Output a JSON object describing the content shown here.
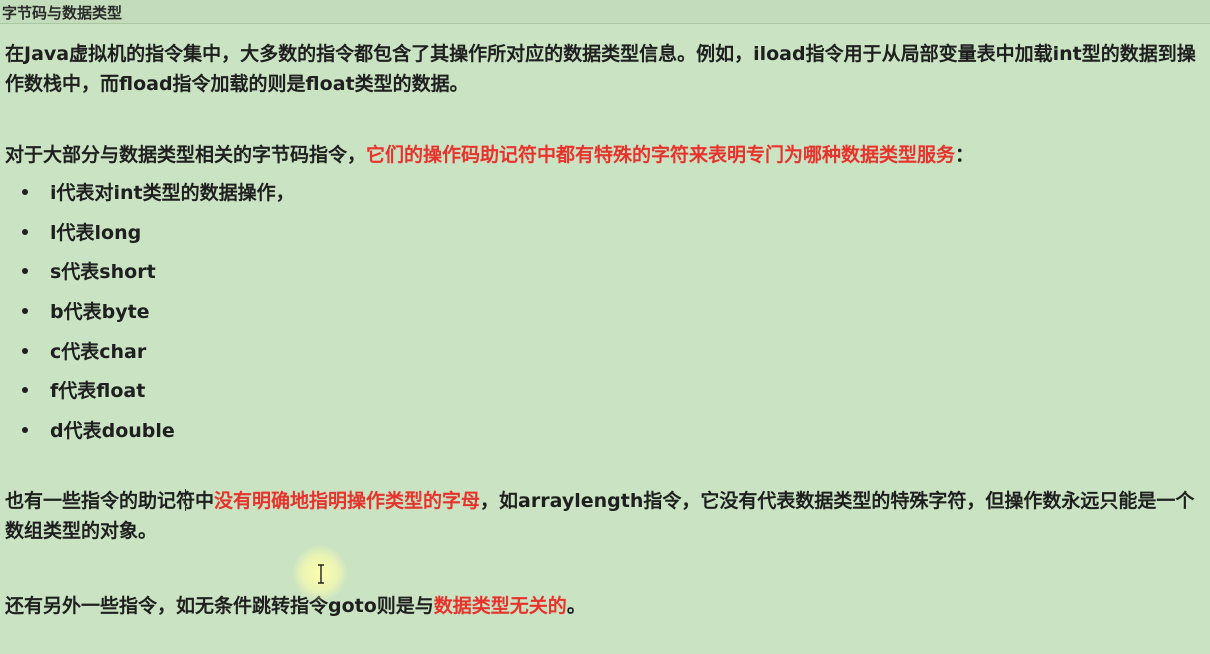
{
  "header": {
    "title": "字节码与数据类型"
  },
  "p1": {
    "text": "在Java虚拟机的指令集中，大多数的指令都包含了其操作所对应的数据类型信息。例如，iload指令用于从局部变量表中加载int型的数据到操作数栈中，而fload指令加载的则是float类型的数据。"
  },
  "p2": {
    "prefix": "对于大部分与数据类型相关的字节码指令，",
    "highlight": "它们的操作码助记符中都有特殊的字符来表明专门为哪种数据类型服务",
    "suffix": "："
  },
  "bullets": [
    "i代表对int类型的数据操作，",
    "l代表long",
    "s代表short",
    "b代表byte",
    "c代表char",
    "f代表float",
    "d代表double"
  ],
  "p3": {
    "prefix": "也有一些指令的助记符中",
    "highlight": "没有明确地指明操作类型的字母",
    "suffix": "，如arraylength指令，它没有代表数据类型的特殊字符，但操作数永远只能是一个数组类型的对象。"
  },
  "p4": {
    "prefix": "还有另外一些指令，如无条件跳转指令goto则是与",
    "highlight": "数据类型无关的",
    "suffix": "。"
  },
  "colors": {
    "background": "#c9e3c3",
    "highlight": "#e8322c",
    "text": "#1f1f1f"
  },
  "icons": {
    "cursor": "text-cursor-icon",
    "bullet": "bullet-dot-icon"
  }
}
